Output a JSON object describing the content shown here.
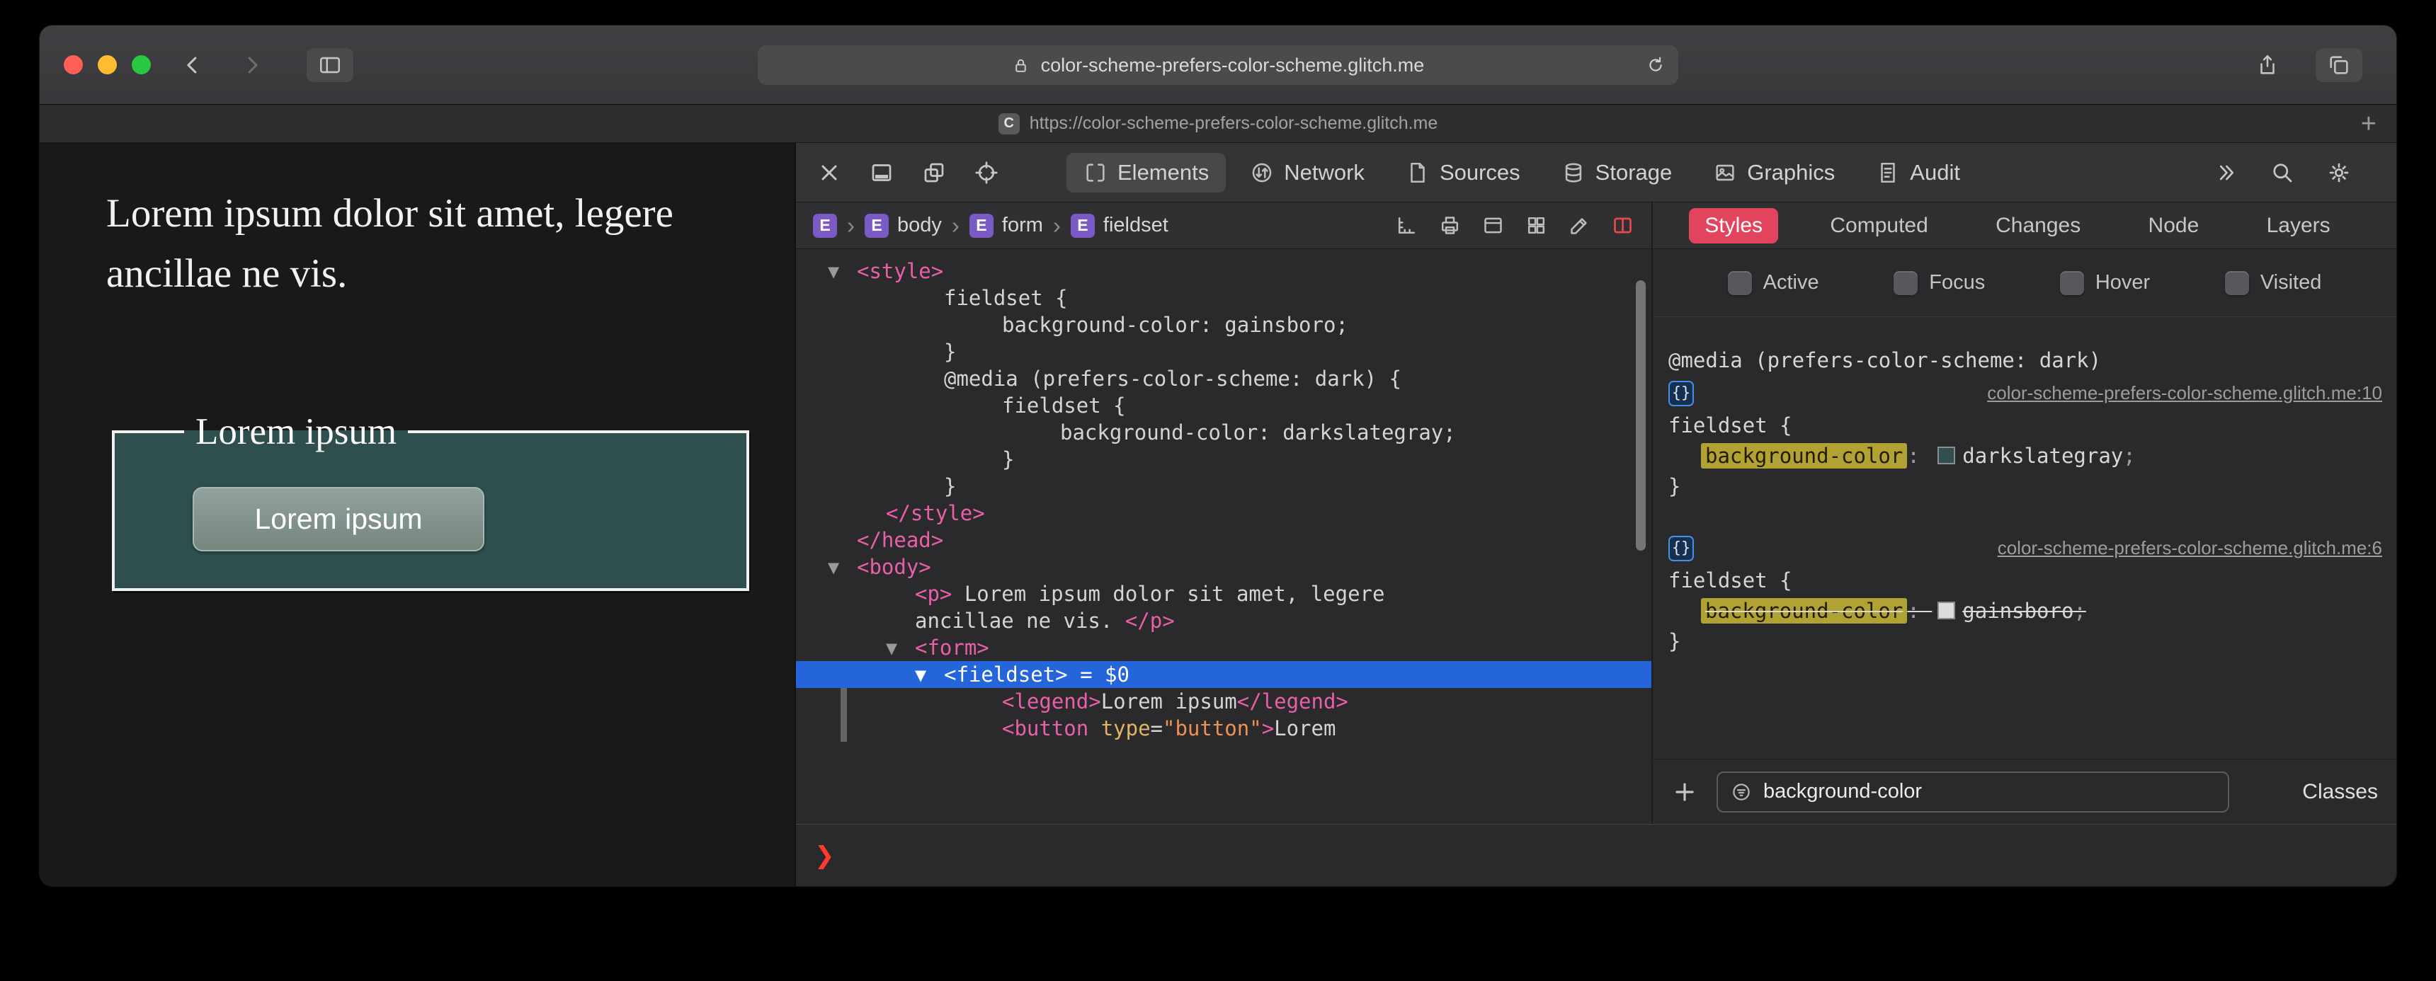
{
  "colors": {
    "accent_red": "#e2445e",
    "selection_blue": "#2565da",
    "highlight_yellow": "#b1a233",
    "fieldset_bg": "#2f4f4f"
  },
  "titlebar": {
    "url": "color-scheme-prefers-color-scheme.glitch.me",
    "lock_icon": "lock-icon",
    "reload_icon": "reload-icon",
    "left_icons": [
      "back-icon",
      "forward-icon",
      "sidebar-icon"
    ],
    "right_icons": [
      "share-icon",
      "tabs-icon"
    ]
  },
  "tabbar": {
    "favicon_letter": "C",
    "tab_title": "https://color-scheme-prefers-color-scheme.glitch.me",
    "new_tab_label": "+"
  },
  "page": {
    "paragraph": "Lorem ipsum dolor sit amet, legere ancillae ne vis.",
    "legend": "Lorem ipsum",
    "button_label": "Lorem ipsum"
  },
  "devtools": {
    "toolbar": {
      "left_icons": [
        "close-icon",
        "dock-bottom-icon",
        "detach-icon",
        "inspect-target-icon"
      ],
      "tabs": [
        {
          "label": "Elements",
          "icon": "elements-icon",
          "active": true
        },
        {
          "label": "Network",
          "icon": "network-icon",
          "active": false
        },
        {
          "label": "Sources",
          "icon": "sources-icon",
          "active": false
        },
        {
          "label": "Storage",
          "icon": "storage-icon",
          "active": false
        },
        {
          "label": "Graphics",
          "icon": "graphics-icon",
          "active": false
        },
        {
          "label": "Audit",
          "icon": "audit-icon",
          "active": false
        }
      ],
      "right_icons": [
        "chevrons-more-icon",
        "search-icon",
        "gear-icon"
      ]
    },
    "breadcrumbs": {
      "items": [
        {
          "badge": "E",
          "label": ""
        },
        {
          "badge": "E",
          "label": "body"
        },
        {
          "badge": "E",
          "label": "form"
        },
        {
          "badge": "E",
          "label": "fieldset"
        }
      ],
      "tool_icons": [
        "rulers-icon",
        "print-styles-icon",
        "screenshot-icon",
        "grid-overlay-icon",
        "edit-icon",
        "paint-flashing-icon"
      ]
    },
    "dom_tree": [
      {
        "pad": 1,
        "tri": true,
        "segs": [
          {
            "t": "<style>",
            "c": "tag"
          }
        ]
      },
      {
        "pad": 4,
        "segs": [
          {
            "t": "fieldset {",
            "c": "code"
          }
        ]
      },
      {
        "pad": 6,
        "segs": [
          {
            "t": "background-color: gainsboro;",
            "c": "code"
          }
        ]
      },
      {
        "pad": 4,
        "segs": [
          {
            "t": "}",
            "c": "code"
          }
        ]
      },
      {
        "pad": 4,
        "segs": [
          {
            "t": "@media (prefers-color-scheme: dark) {",
            "c": "code"
          }
        ]
      },
      {
        "pad": 6,
        "segs": [
          {
            "t": "fieldset {",
            "c": "code"
          }
        ]
      },
      {
        "pad": 8,
        "segs": [
          {
            "t": "background-color: darkslategray;",
            "c": "code"
          }
        ]
      },
      {
        "pad": 6,
        "segs": [
          {
            "t": "}",
            "c": "code"
          }
        ]
      },
      {
        "pad": 4,
        "segs": [
          {
            "t": "}",
            "c": "code"
          }
        ]
      },
      {
        "pad": 2,
        "segs": [
          {
            "t": "</style>",
            "c": "tag"
          }
        ]
      },
      {
        "pad": 1,
        "segs": [
          {
            "t": "</head>",
            "c": "tag"
          }
        ]
      },
      {
        "pad": 1,
        "tri": true,
        "segs": [
          {
            "t": "<body>",
            "c": "tag"
          }
        ]
      },
      {
        "pad": 3,
        "segs": [
          {
            "t": "<p>",
            "c": "tag"
          },
          {
            "t": " Lorem ipsum dolor sit amet, legere",
            "c": "code"
          }
        ]
      },
      {
        "pad": 3,
        "segs": [
          {
            "t": "ancillae ne vis. ",
            "c": "code"
          },
          {
            "t": "</p>",
            "c": "tag"
          }
        ]
      },
      {
        "pad": 3,
        "tri": true,
        "segs": [
          {
            "t": "<form>",
            "c": "tag"
          }
        ]
      },
      {
        "pad": 4,
        "tri": true,
        "selected": true,
        "segs": [
          {
            "t": "<fieldset>",
            "c": "tag"
          },
          {
            "t": " = $0",
            "c": "code"
          }
        ]
      },
      {
        "pad": 6,
        "gutter": true,
        "segs": [
          {
            "t": "<legend>",
            "c": "tag"
          },
          {
            "t": "Lorem ipsum",
            "c": "code"
          },
          {
            "t": "</legend>",
            "c": "tag"
          }
        ]
      },
      {
        "pad": 6,
        "gutter": true,
        "segs": [
          {
            "t": "<button ",
            "c": "tag"
          },
          {
            "t": "type",
            "c": "attr"
          },
          {
            "t": "=",
            "c": "code"
          },
          {
            "t": "\"button\"",
            "c": "val"
          },
          {
            "t": ">",
            "c": "tag"
          },
          {
            "t": "Lorem",
            "c": "code"
          }
        ]
      }
    ],
    "console": {
      "prompt": "❯"
    },
    "styles_sidebar": {
      "tabs": [
        {
          "label": "Styles",
          "active": true
        },
        {
          "label": "Computed",
          "active": false
        },
        {
          "label": "Changes",
          "active": false
        },
        {
          "label": "Node",
          "active": false
        },
        {
          "label": "Layers",
          "active": false
        }
      ],
      "pseudo_toggles": [
        "Active",
        "Focus",
        "Hover",
        "Visited"
      ],
      "rules": [
        {
          "media": "@media (prefers-color-scheme: dark)",
          "badge": "{}",
          "source_link": "color-scheme-prefers-color-scheme.glitch.me:10",
          "selector": "fieldset {",
          "declarations": [
            {
              "property": "background-color",
              "value": "darkslategray",
              "swatch": "#2f4f4f",
              "highlighted": true,
              "overridden": false
            }
          ],
          "close": "}"
        },
        {
          "media": "",
          "badge": "{}",
          "source_link": "color-scheme-prefers-color-scheme.glitch.me:6",
          "selector": "fieldset {",
          "declarations": [
            {
              "property": "background-color",
              "value": "gainsboro",
              "swatch": "#dcdcdc",
              "highlighted": true,
              "overridden": true
            }
          ],
          "close": "}"
        }
      ],
      "footer": {
        "add_icon": "plus-icon",
        "filter_icon": "filter-icon",
        "filter_value": "background-color",
        "classes_label": "Classes"
      }
    }
  }
}
